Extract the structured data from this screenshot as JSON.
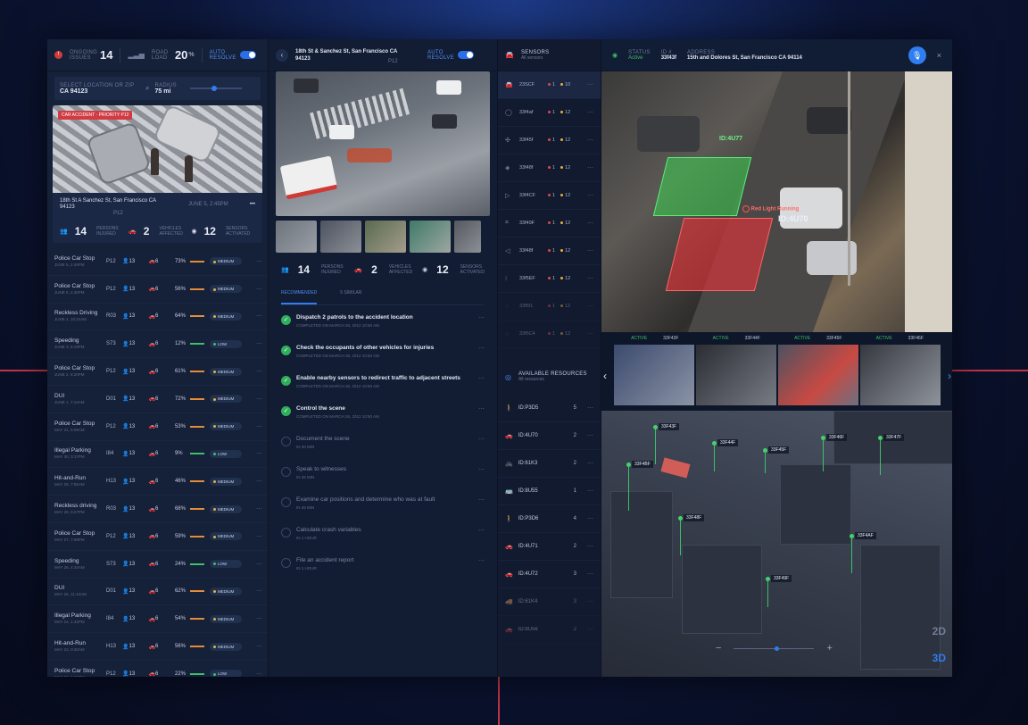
{
  "summary": {
    "ongoing_label": "ONGOING ISSUES",
    "ongoing_badge": "!",
    "ongoing_count": "14",
    "road_label": "ROAD LOAD",
    "road_value": "20",
    "road_unit": "%",
    "auto_resolve_label": "AUTO RESOLVE"
  },
  "search": {
    "location_label": "SELECT LOCATION OR ZIP",
    "location_value": "CA 94123",
    "radius_label": "RADIUS",
    "radius_value": "75 mi"
  },
  "active_incident": {
    "tags": "CAR ACCIDENT · PRIORITY P12",
    "address": "18th St A Sanchez St, San Francisco CA 94123",
    "date": "JUNE 5, 2:45PM",
    "code": "P12",
    "persons": "14",
    "persons_label": "PERSONS INJURED",
    "vehicles": "2",
    "vehicles_label": "VEHICLES AFFECTED",
    "sensors": "12",
    "sensors_label": "SENSORS ACTIVATED"
  },
  "incidents": [
    {
      "name": "Police Car Stop",
      "date": "JUNE 5, 2:45PM",
      "code": "P12",
      "people": "13",
      "vehicles": "6",
      "pct": "73%",
      "level": "MEDIUM"
    },
    {
      "name": "Police Car Stop",
      "date": "JUNE 5, 2:45PM",
      "code": "P12",
      "people": "13",
      "vehicles": "6",
      "pct": "56%",
      "level": "MEDIUM"
    },
    {
      "name": "Reckless Driving",
      "date": "JUNE 4, 10:24AM",
      "code": "R03",
      "people": "13",
      "vehicles": "6",
      "pct": "64%",
      "level": "MEDIUM"
    },
    {
      "name": "Speeding",
      "date": "JUNE 3, 8:19PM",
      "code": "S73",
      "people": "13",
      "vehicles": "6",
      "pct": "12%",
      "level": "LOW"
    },
    {
      "name": "Police Car Stop",
      "date": "JUNE 2, 8:20PM",
      "code": "P12",
      "people": "13",
      "vehicles": "6",
      "pct": "61%",
      "level": "MEDIUM"
    },
    {
      "name": "DUI",
      "date": "JUNE 1, 7:14AM",
      "code": "D01",
      "people": "13",
      "vehicles": "6",
      "pct": "72%",
      "level": "MEDIUM"
    },
    {
      "name": "Police Car Stop",
      "date": "MAY 31, 5:09AM",
      "code": "P12",
      "people": "13",
      "vehicles": "6",
      "pct": "53%",
      "level": "MEDIUM"
    },
    {
      "name": "Illegal Parking",
      "date": "MAY 30, 3:17PM",
      "code": "I84",
      "people": "13",
      "vehicles": "6",
      "pct": "9%",
      "level": "LOW"
    },
    {
      "name": "Hit-and-Run",
      "date": "MAY 29, 7:55AM",
      "code": "H13",
      "people": "13",
      "vehicles": "6",
      "pct": "46%",
      "level": "MEDIUM"
    },
    {
      "name": "Reckless driving",
      "date": "MAY 28, 8:27PM",
      "code": "R03",
      "people": "13",
      "vehicles": "6",
      "pct": "68%",
      "level": "MEDIUM"
    },
    {
      "name": "Police Car Stop",
      "date": "MAY 27, 7:08PM",
      "code": "P12",
      "people": "13",
      "vehicles": "6",
      "pct": "59%",
      "level": "MEDIUM"
    },
    {
      "name": "Speeding",
      "date": "MAY 26, 4:34AM",
      "code": "S73",
      "people": "13",
      "vehicles": "6",
      "pct": "24%",
      "level": "LOW"
    },
    {
      "name": "DUI",
      "date": "MAY 25, 11:10AM",
      "code": "D01",
      "people": "13",
      "vehicles": "6",
      "pct": "62%",
      "level": "MEDIUM"
    },
    {
      "name": "Illegal Parking",
      "date": "MAY 24, 1:42PM",
      "code": "I84",
      "people": "13",
      "vehicles": "6",
      "pct": "54%",
      "level": "MEDIUM"
    },
    {
      "name": "Hit-and-Run",
      "date": "MAY 23, 9:30AM",
      "code": "H13",
      "people": "13",
      "vehicles": "6",
      "pct": "56%",
      "level": "MEDIUM"
    },
    {
      "name": "Police Car Stop",
      "date": "MAY 22, 6:15PM",
      "code": "P12",
      "people": "13",
      "vehicles": "6",
      "pct": "22%",
      "level": "LOW"
    }
  ],
  "detail": {
    "address": "18th St & Sanchez St, San Francisco CA 94123",
    "code": "P12",
    "auto_resolve_label": "AUTO RESOLVE",
    "persons": "14",
    "persons_label": "PERSONS INJURED",
    "vehicles": "2",
    "vehicles_label": "VEHICLES AFFECTED",
    "sensors": "12",
    "sensors_label": "SENSORS ACTIVATED",
    "tab_recommended": "RECOMMENDED",
    "tab_similar": "5 SIMILAR"
  },
  "tasks": [
    {
      "title": "Dispatch 2 patrols to the accident location",
      "sub": "COMPLETED ON MARCH 26, 2012 10:50 AM",
      "done": true
    },
    {
      "title": "Check the occupants of other vehicles for injuries",
      "sub": "COMPLETED ON MARCH 26, 2012 10:50 AM",
      "done": true
    },
    {
      "title": "Enable nearby sensors to redirect traffic to adjacent streets",
      "sub": "COMPLETED ON MARCH 26, 2012 10:50 AM",
      "done": true
    },
    {
      "title": "Control the scene",
      "sub": "COMPLETED ON MARCH 26, 2012 10:50 AM",
      "done": true
    },
    {
      "title": "Document the scene",
      "sub": "IN 20 MIN",
      "done": false
    },
    {
      "title": "Speak to witnesses",
      "sub": "IN 25 MIN",
      "done": false
    },
    {
      "title": "Examine car positions and determine who was at fault",
      "sub": "IN 45 MIN",
      "done": false
    },
    {
      "title": "Calculate crash variables",
      "sub": "IN 1 HOUR",
      "done": false
    },
    {
      "title": "File an accident report",
      "sub": "IN 1 HOUR",
      "done": false
    }
  ],
  "sensors": {
    "title": "SENSORS",
    "filter": "All sensors",
    "items": [
      {
        "id": "23SCF",
        "red": "1",
        "yellow": "10"
      },
      {
        "id": "33f4af",
        "red": "1",
        "yellow": "12"
      },
      {
        "id": "33f45f",
        "red": "1",
        "yellow": "12"
      },
      {
        "id": "33f48f",
        "red": "1",
        "yellow": "12"
      },
      {
        "id": "33f4CF",
        "red": "1",
        "yellow": "12"
      },
      {
        "id": "33f49F",
        "red": "1",
        "yellow": "12"
      },
      {
        "id": "33f48f",
        "red": "1",
        "yellow": "12"
      },
      {
        "id": "33f5EF",
        "red": "1",
        "yellow": "12"
      },
      {
        "id": "33f5f1",
        "red": "1",
        "yellow": "12"
      },
      {
        "id": "33f5C4",
        "red": "1",
        "yellow": "12"
      }
    ]
  },
  "resources": {
    "title": "AVAILABLE RESOURCES",
    "filter": "All resources",
    "items": [
      {
        "id": "ID:P3D5",
        "count": "5"
      },
      {
        "id": "ID:4U70",
        "count": "2"
      },
      {
        "id": "ID:61K3",
        "count": "2"
      },
      {
        "id": "ID:8U55",
        "count": "1"
      },
      {
        "id": "ID:P3D6",
        "count": "4"
      },
      {
        "id": "ID:4U71",
        "count": "2"
      },
      {
        "id": "ID:4U72",
        "count": "3"
      },
      {
        "id": "ID:61K4",
        "count": "3"
      },
      {
        "id": "ID:8U56",
        "count": "2"
      }
    ]
  },
  "status_bar": {
    "status_label": "STATUS",
    "status_value": "Active",
    "id_label": "ID #",
    "id_value": "33f43f",
    "address_label": "ADDRESS",
    "address_value": "15th and Dolores St, San Francisco CA 94114"
  },
  "feed": {
    "green_id": "ID:4U77",
    "alert_text": "Red Light Running",
    "red_id": "ID:4U70"
  },
  "cameras": [
    {
      "status": "ACTIVE",
      "id": "33F43F"
    },
    {
      "status": "ACTIVE",
      "id": "33F44F"
    },
    {
      "status": "ACTIVE",
      "id": "33F45F"
    },
    {
      "status": "ACTIVE",
      "id": "33F46F"
    }
  ],
  "map_pins": [
    "33F43F",
    "33F44F",
    "33F45F",
    "33F46F",
    "33F47F",
    "33F48F",
    "33F49F",
    "33F4AF",
    "33F4BF"
  ],
  "map": {
    "view_2d": "2D",
    "view_3d": "3D",
    "zoom_out": "−",
    "zoom_in": "+"
  },
  "colors": {
    "accent": "#2f7df0",
    "alert_red": "#d33b43",
    "ok_green": "#2fae5c",
    "warning_yellow": "#e5b23a"
  }
}
